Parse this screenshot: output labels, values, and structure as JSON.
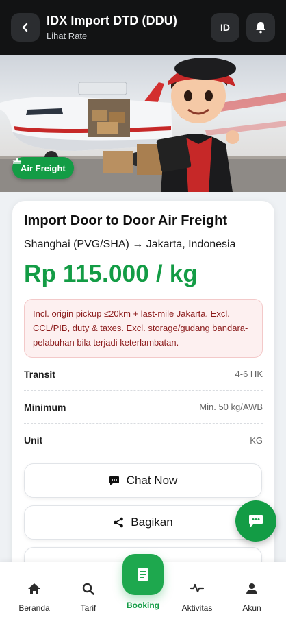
{
  "header": {
    "title": "IDX Import DTD (DDU)",
    "subtitle": "Lihat Rate",
    "lang": "ID"
  },
  "hero": {
    "badge": "Air Freight"
  },
  "rate": {
    "title": "Import Door to Door Air Freight",
    "route": "Shanghai (PVG/SHA) → Jakarta, Indonesia",
    "price": "Rp 115.000 / kg",
    "note": "Incl. origin pickup ≤20km + last-mile Jakarta. Excl. CCL/PIB, duty & taxes. Excl. storage/gudang bandara-pelabuhan bila terjadi keterlambatan.",
    "details": [
      {
        "label": "Transit",
        "value": "4-6 HK"
      },
      {
        "label": "Minimum",
        "value": "Min. 50 kg/AWB"
      },
      {
        "label": "Unit",
        "value": "KG"
      }
    ]
  },
  "actions": {
    "chat": "Chat Now",
    "share": "Bagikan"
  },
  "nav": {
    "items": [
      {
        "label": "Beranda",
        "icon": "home-icon"
      },
      {
        "label": "Tarif",
        "icon": "search-icon"
      },
      {
        "label": "Booking",
        "icon": "booking-icon"
      },
      {
        "label": "Aktivitas",
        "icon": "activity-icon"
      },
      {
        "label": "Akun",
        "icon": "user-icon"
      }
    ]
  },
  "colors": {
    "brand": "#139c45",
    "header_bg": "#121314",
    "note_bg": "#fdf0f0",
    "note_text": "#8b1b1b"
  }
}
